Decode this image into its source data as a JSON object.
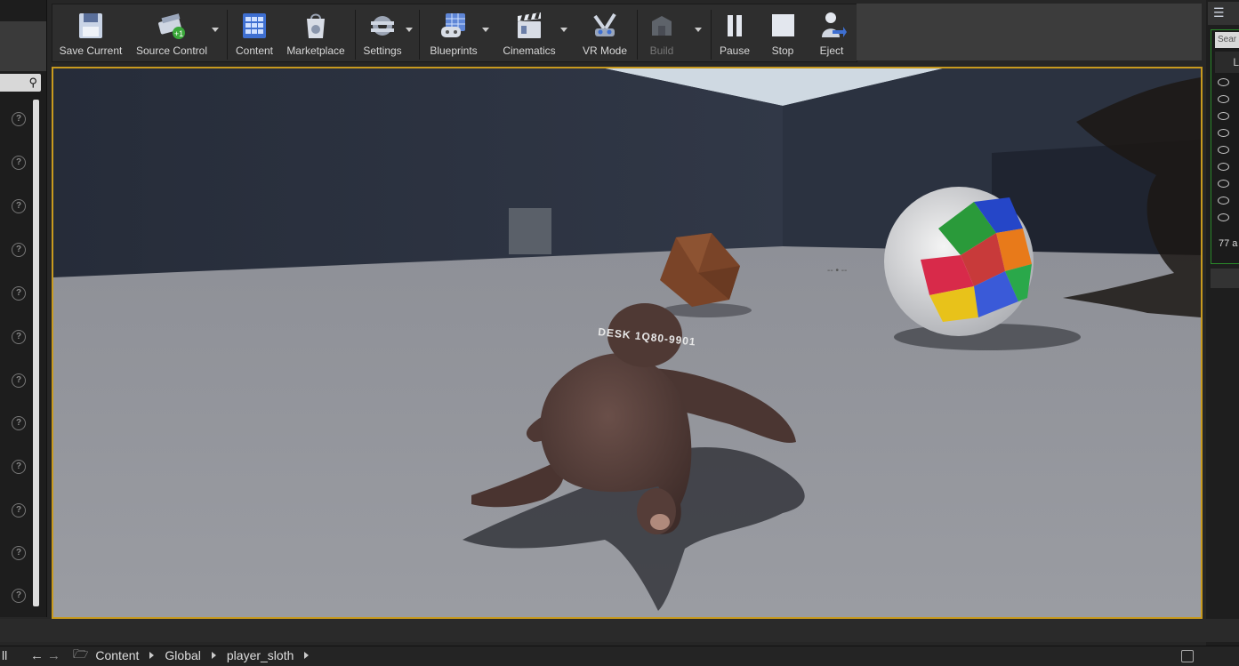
{
  "toolbar": {
    "items": [
      {
        "label": "Save Current",
        "icon": "save-icon"
      },
      {
        "label": "Source Control",
        "icon": "source-control-icon"
      },
      {
        "label": "Content",
        "icon": "content-icon"
      },
      {
        "label": "Marketplace",
        "icon": "marketplace-icon"
      },
      {
        "label": "Settings",
        "icon": "settings-icon"
      },
      {
        "label": "Blueprints",
        "icon": "blueprints-icon"
      },
      {
        "label": "Cinematics",
        "icon": "cinematics-icon"
      },
      {
        "label": "VR Mode",
        "icon": "vr-mode-icon"
      },
      {
        "label": "Build",
        "icon": "build-icon",
        "disabled": true
      },
      {
        "label": "Pause",
        "icon": "pause-icon"
      },
      {
        "label": "Stop",
        "icon": "stop-icon"
      },
      {
        "label": "Eject",
        "icon": "eject-icon"
      }
    ]
  },
  "viewport": {
    "overlay_text": "DESK 1Q80-9901"
  },
  "right_panel": {
    "search_placeholder": "Sear",
    "header_label": "L",
    "count_text": "77 a"
  },
  "content_browser": {
    "left_label": "ll",
    "breadcrumbs": [
      "Content",
      "Global",
      "player_sloth"
    ]
  },
  "colors": {
    "viewport_border": "#c89a1e",
    "panel_bg": "#262626"
  }
}
